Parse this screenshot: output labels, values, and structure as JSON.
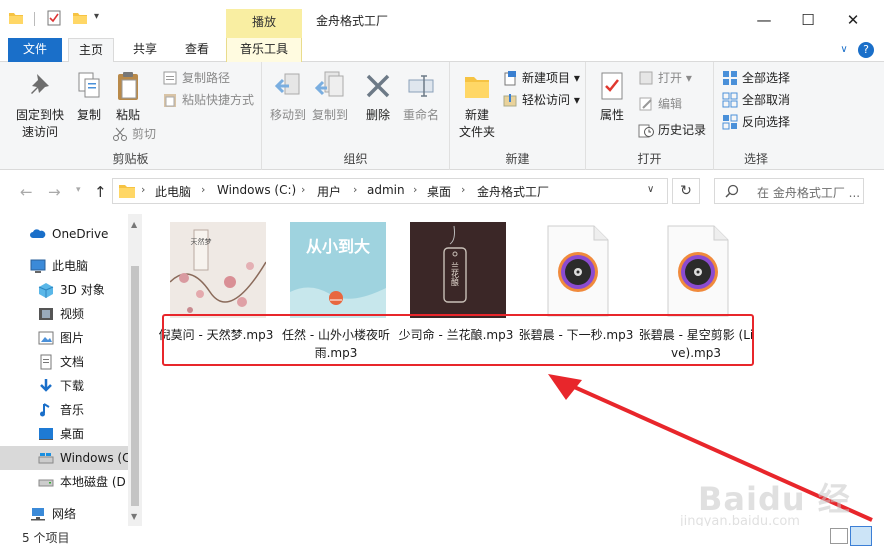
{
  "window": {
    "title": "金舟格式工厂",
    "contextual_tab_header": "播放"
  },
  "ribbon_tabs": {
    "file": "文件",
    "home": "主页",
    "share": "共享",
    "view": "查看",
    "music_tools": "音乐工具"
  },
  "ribbon": {
    "clipboard": {
      "group_label": "剪贴板",
      "pin_quick_access": [
        "固定到快",
        "速访问"
      ],
      "copy": "复制",
      "paste": "粘贴",
      "copy_path": "复制路径",
      "paste_shortcut": "粘贴快捷方式",
      "cut": "剪切"
    },
    "organize": {
      "group_label": "组织",
      "move_to": "移动到",
      "copy_to": "复制到",
      "delete": "删除",
      "rename": "重命名"
    },
    "new": {
      "group_label": "新建",
      "new_folder": [
        "新建",
        "文件夹"
      ],
      "new_item": "新建项目",
      "easy_access": "轻松访问"
    },
    "open": {
      "group_label": "打开",
      "properties": "属性",
      "open": "打开",
      "edit": "编辑",
      "history": "历史记录"
    },
    "select": {
      "group_label": "选择",
      "select_all": "全部选择",
      "select_none": "全部取消",
      "invert_selection": "反向选择"
    }
  },
  "address": {
    "crumbs": [
      "此电脑",
      "Windows (C:)",
      "用户",
      "admin",
      "桌面",
      "金舟格式工厂"
    ],
    "search_placeholder": "在 金舟格式工厂 ..."
  },
  "nav_pane": {
    "items": [
      {
        "label": "OneDrive",
        "icon": "cloud-icon"
      },
      {
        "label": "此电脑",
        "icon": "computer-icon"
      },
      {
        "label": "3D 对象",
        "icon": "3d-objects-icon"
      },
      {
        "label": "视频",
        "icon": "video-icon"
      },
      {
        "label": "图片",
        "icon": "pictures-icon"
      },
      {
        "label": "文档",
        "icon": "documents-icon"
      },
      {
        "label": "下载",
        "icon": "download-icon"
      },
      {
        "label": "音乐",
        "icon": "music-icon"
      },
      {
        "label": "桌面",
        "icon": "desktop-icon"
      },
      {
        "label": "Windows (C",
        "icon": "drive-icon"
      },
      {
        "label": "本地磁盘 (D",
        "icon": "disk-icon"
      },
      {
        "label": "网络",
        "icon": "network-icon"
      }
    ]
  },
  "files": [
    {
      "name": "倪莫问 - 天然梦.mp3",
      "thumb": "album-art-floral",
      "thumb_text": "天然梦"
    },
    {
      "name": "任然 - 山外小楼夜听雨.mp3",
      "thumb": "album-art-sky",
      "thumb_text": "从小到大"
    },
    {
      "name": "少司命 - 兰花酿.mp3",
      "thumb": "album-art-dark",
      "thumb_text": "兰花酿"
    },
    {
      "name": "张碧晨 - 下一秒.mp3",
      "thumb": "music-file-icon"
    },
    {
      "name": "张碧晨 - 星空剪影 (Live).mp3",
      "thumb": "music-file-icon"
    }
  ],
  "status": {
    "item_count": "5 个项目"
  },
  "watermark": {
    "text": "Baidu 经验",
    "sub": "jingyan.baidu.com"
  },
  "colors": {
    "accent": "#1a6fc9",
    "contextual_tab": "#f9eea2",
    "highlight": "#e8262b"
  }
}
